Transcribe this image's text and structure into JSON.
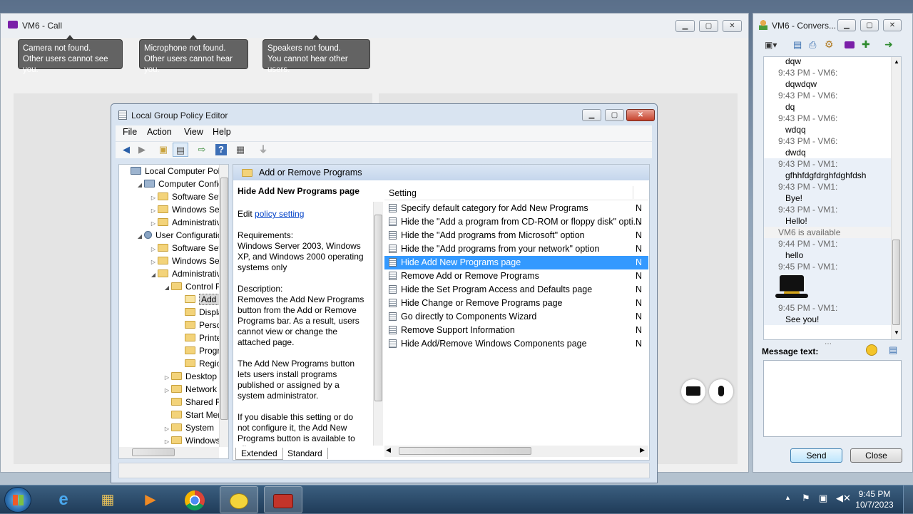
{
  "call_window": {
    "title": "VM6 - Call",
    "notices": [
      {
        "line1": "Camera not found.",
        "line2": "Other users cannot see you."
      },
      {
        "line1": "Microphone not found.",
        "line2": "Other users cannot hear you."
      },
      {
        "line1": "Speakers not found.",
        "line2": "You cannot hear other users."
      }
    ]
  },
  "gpe": {
    "title": "Local Group Policy Editor",
    "menu": [
      "File",
      "Action",
      "View",
      "Help"
    ],
    "tree": [
      {
        "label": "Local Computer Polic",
        "depth": 0,
        "expander": "",
        "icon": "computer-icon"
      },
      {
        "label": "Computer Config",
        "depth": 1,
        "expander": "◢",
        "icon": "computer-icon"
      },
      {
        "label": "Software Setti",
        "depth": 2,
        "expander": "▷",
        "icon": "folder-icon"
      },
      {
        "label": "Windows Sett",
        "depth": 2,
        "expander": "▷",
        "icon": "folder-icon"
      },
      {
        "label": "Administrative",
        "depth": 2,
        "expander": "▷",
        "icon": "folder-icon"
      },
      {
        "label": "User Configuratio",
        "depth": 1,
        "expander": "◢",
        "icon": "user-icon"
      },
      {
        "label": "Software Setti",
        "depth": 2,
        "expander": "▷",
        "icon": "folder-icon"
      },
      {
        "label": "Windows Sett",
        "depth": 2,
        "expander": "▷",
        "icon": "folder-icon"
      },
      {
        "label": "Administrative",
        "depth": 2,
        "expander": "◢",
        "icon": "folder-icon"
      },
      {
        "label": "Control Pa",
        "depth": 3,
        "expander": "◢",
        "icon": "folder-icon"
      },
      {
        "label": "Add or",
        "depth": 4,
        "expander": "",
        "icon": "folder-icon",
        "selected": true
      },
      {
        "label": "Display",
        "depth": 4,
        "expander": "",
        "icon": "folder-icon"
      },
      {
        "label": "Person",
        "depth": 4,
        "expander": "",
        "icon": "folder-icon"
      },
      {
        "label": "Printer",
        "depth": 4,
        "expander": "",
        "icon": "folder-icon"
      },
      {
        "label": "Progra",
        "depth": 4,
        "expander": "",
        "icon": "folder-icon"
      },
      {
        "label": "Region",
        "depth": 4,
        "expander": "",
        "icon": "folder-icon"
      },
      {
        "label": "Desktop",
        "depth": 3,
        "expander": "▷",
        "icon": "folder-icon"
      },
      {
        "label": "Network",
        "depth": 3,
        "expander": "▷",
        "icon": "folder-icon"
      },
      {
        "label": "Shared Fol",
        "depth": 3,
        "expander": "",
        "icon": "folder-icon"
      },
      {
        "label": "Start Menu",
        "depth": 3,
        "expander": "",
        "icon": "folder-icon"
      },
      {
        "label": "System",
        "depth": 3,
        "expander": "▷",
        "icon": "folder-icon"
      },
      {
        "label": "Windows",
        "depth": 3,
        "expander": "▷",
        "icon": "folder-icon"
      }
    ],
    "folder_header": "Add or Remove Programs",
    "desc": {
      "title": "Hide Add New Programs page",
      "edit_prefix": "Edit ",
      "edit_link": "policy setting ",
      "requirements_label": "Requirements:",
      "requirements_text": "Windows Server 2003, Windows XP, and Windows 2000 operating systems only",
      "description_label": "Description:",
      "p1": "Removes the Add New Programs button from the Add or Remove Programs bar. As a result, users cannot view or change the attached page.",
      "p2": "The Add New Programs button lets users install programs published or assigned by a system administrator.",
      "p3": "If you disable this setting or do not configure it, the Add New Programs button is available to all"
    },
    "settings_header": "Setting",
    "settings": [
      {
        "name": "Specify default category for Add New Programs",
        "state": "N"
      },
      {
        "name": "Hide the \"Add a program from CD-ROM or floppy disk\" opti...",
        "state": "N"
      },
      {
        "name": "Hide the \"Add programs from Microsoft\" option",
        "state": "N"
      },
      {
        "name": "Hide the \"Add programs from your network\" option",
        "state": "N"
      },
      {
        "name": "Hide Add New Programs page",
        "state": "N",
        "selected": true
      },
      {
        "name": "Remove Add or Remove Programs",
        "state": "N"
      },
      {
        "name": "Hide the Set Program Access and Defaults page",
        "state": "N"
      },
      {
        "name": "Hide Change or Remove Programs page",
        "state": "N"
      },
      {
        "name": "Go directly to Components Wizard",
        "state": "N"
      },
      {
        "name": "Remove Support Information",
        "state": "N"
      },
      {
        "name": "Hide Add/Remove Windows Components page",
        "state": "N"
      }
    ],
    "tabs": [
      "Extended",
      "Standard"
    ]
  },
  "conversation": {
    "title": "VM6 - Convers...",
    "lines": [
      {
        "kind": "msg",
        "text": "dqw",
        "shade": false
      },
      {
        "kind": "meta",
        "text": "9:43 PM - VM6:",
        "shade": false
      },
      {
        "kind": "msg",
        "text": "dqwdqw",
        "shade": false
      },
      {
        "kind": "meta",
        "text": "9:43 PM - VM6:",
        "shade": false
      },
      {
        "kind": "msg",
        "text": "dq",
        "shade": false
      },
      {
        "kind": "meta",
        "text": "9:43 PM - VM6:",
        "shade": false
      },
      {
        "kind": "msg",
        "text": "wdqq",
        "shade": false
      },
      {
        "kind": "meta",
        "text": "9:43 PM - VM6:",
        "shade": false
      },
      {
        "kind": "msg",
        "text": "dwdq",
        "shade": false
      },
      {
        "kind": "meta",
        "text": "9:43 PM - VM1:",
        "shade": true
      },
      {
        "kind": "msg",
        "text": "gfhhfdgfdrghfdghfdsh",
        "shade": true
      },
      {
        "kind": "meta",
        "text": "9:43 PM - VM1:",
        "shade": true
      },
      {
        "kind": "msg",
        "text": "Bye!",
        "shade": true
      },
      {
        "kind": "meta",
        "text": "9:43 PM - VM1:",
        "shade": true
      },
      {
        "kind": "msg",
        "text": "Hello!",
        "shade": true
      },
      {
        "kind": "meta",
        "text": "VM6 is available",
        "shade": false,
        "status": true
      },
      {
        "kind": "meta",
        "text": "9:44 PM - VM1:",
        "shade": true
      },
      {
        "kind": "msg",
        "text": "hello",
        "shade": true
      },
      {
        "kind": "meta",
        "text": "9:45 PM - VM1:",
        "shade": true
      },
      {
        "kind": "emoticon",
        "text": "",
        "shade": true
      },
      {
        "kind": "meta",
        "text": "9:45 PM - VM1:",
        "shade": true
      },
      {
        "kind": "msg",
        "text": "See you!",
        "shade": true
      }
    ],
    "message_label": "Message text:",
    "message_value": "",
    "send_label": "Send",
    "close_label": "Close"
  },
  "taskbar": {
    "time": "9:45 PM",
    "date": "10/7/2023",
    "apps": [
      "ie-icon",
      "explorer-icon",
      "media-player-icon",
      "chrome-icon",
      "chat-icon",
      "toolbox-icon"
    ]
  }
}
